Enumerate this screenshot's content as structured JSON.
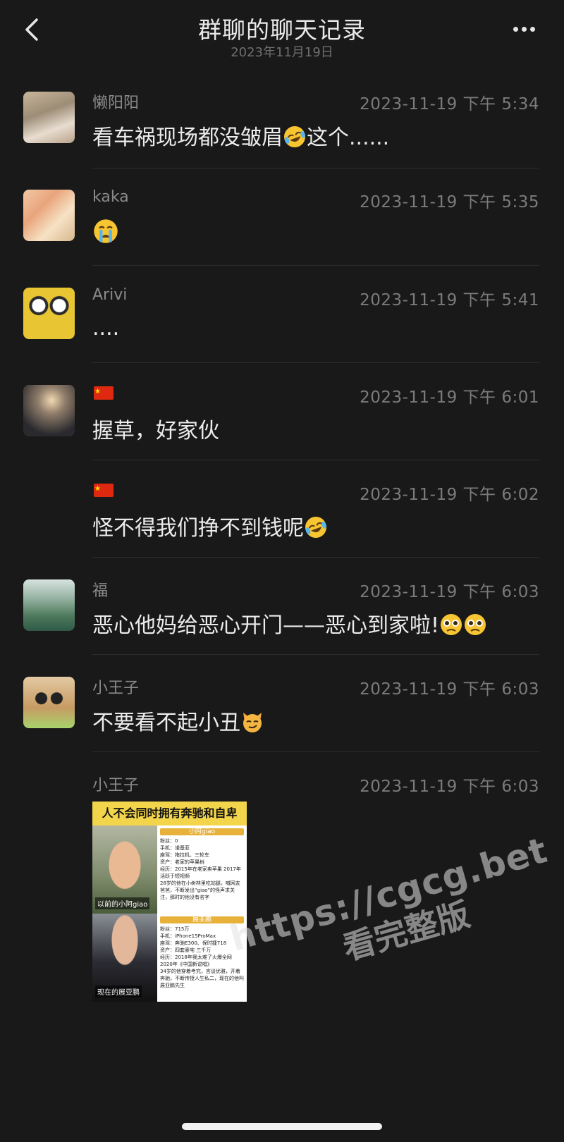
{
  "header": {
    "title": "群聊的聊天记录",
    "date": "2023年11月19日"
  },
  "messages": [
    {
      "sender": "懒阳阳",
      "time": "2023-11-19 下午 5:34",
      "text": "看车祸现场都没皱眉",
      "text_after": "这个......"
    },
    {
      "sender": "kaka",
      "time": "2023-11-19 下午 5:35",
      "text": ""
    },
    {
      "sender": "Arivi",
      "time": "2023-11-19 下午 5:41",
      "text": "...."
    },
    {
      "sender": "",
      "time": "2023-11-19 下午 6:01",
      "text": "握草，好家伙"
    },
    {
      "sender": "",
      "time": "2023-11-19 下午 6:02",
      "text": "怪不得我们挣不到钱呢"
    },
    {
      "sender": "福",
      "time": "2023-11-19 下午 6:03",
      "text": "恶心他妈给恶心开门——恶心到家啦!"
    },
    {
      "sender": "小王子",
      "time": "2023-11-19 下午 6:03",
      "text": "不要看不起小丑"
    },
    {
      "sender": "小王子",
      "time": "2023-11-19 下午 6:03"
    }
  ],
  "image_card": {
    "title": "人不会同时拥有奔驰和自卑",
    "person1": {
      "name": "小阿giao",
      "caption": "以前的小阿giao",
      "lines": [
        "粉丝：0",
        "手机：诺基亚",
        "座驾：拖拉机、三轮车",
        "资产：老家的苹果树",
        "经历：2015年在老家卖苹果 2017年活跃于短视频",
        "28岁的他在小树林里吃站腿，喊网友爸爸，不断发出“giao”的怪声求关注，那时的他没有名字"
      ]
    },
    "person2": {
      "name": "展亚鹏",
      "caption": "现在的展亚鹏",
      "lines": [
        "粉丝：715万",
        "手机：iPhone15ProMax",
        "座驾：奔驰E300、保时捷718",
        "资产：四套豪宅 三千万",
        "经历：2018年我太难了火爆全网 2020年《中国新说唱》",
        "34岁的他穿着考究，言谈优雅，开着奔驰，不断传授人生私二，现在的他叫展亚鹏先生"
      ]
    }
  },
  "watermark": {
    "url": "https://cgcg.bet",
    "text": "看完整版"
  },
  "colors": {
    "background": "#191919",
    "text": "#ececec",
    "secondary": "#7b7b7b",
    "card_title_bg": "#f3d54b"
  },
  "icons": [
    "back-arrow-icon",
    "more-dots-icon",
    "china-flag-icon",
    "laughing-crying-emoji-icon",
    "crying-emoji-icon",
    "pleading-emoji-icon",
    "smirk-cat-emoji-icon"
  ]
}
